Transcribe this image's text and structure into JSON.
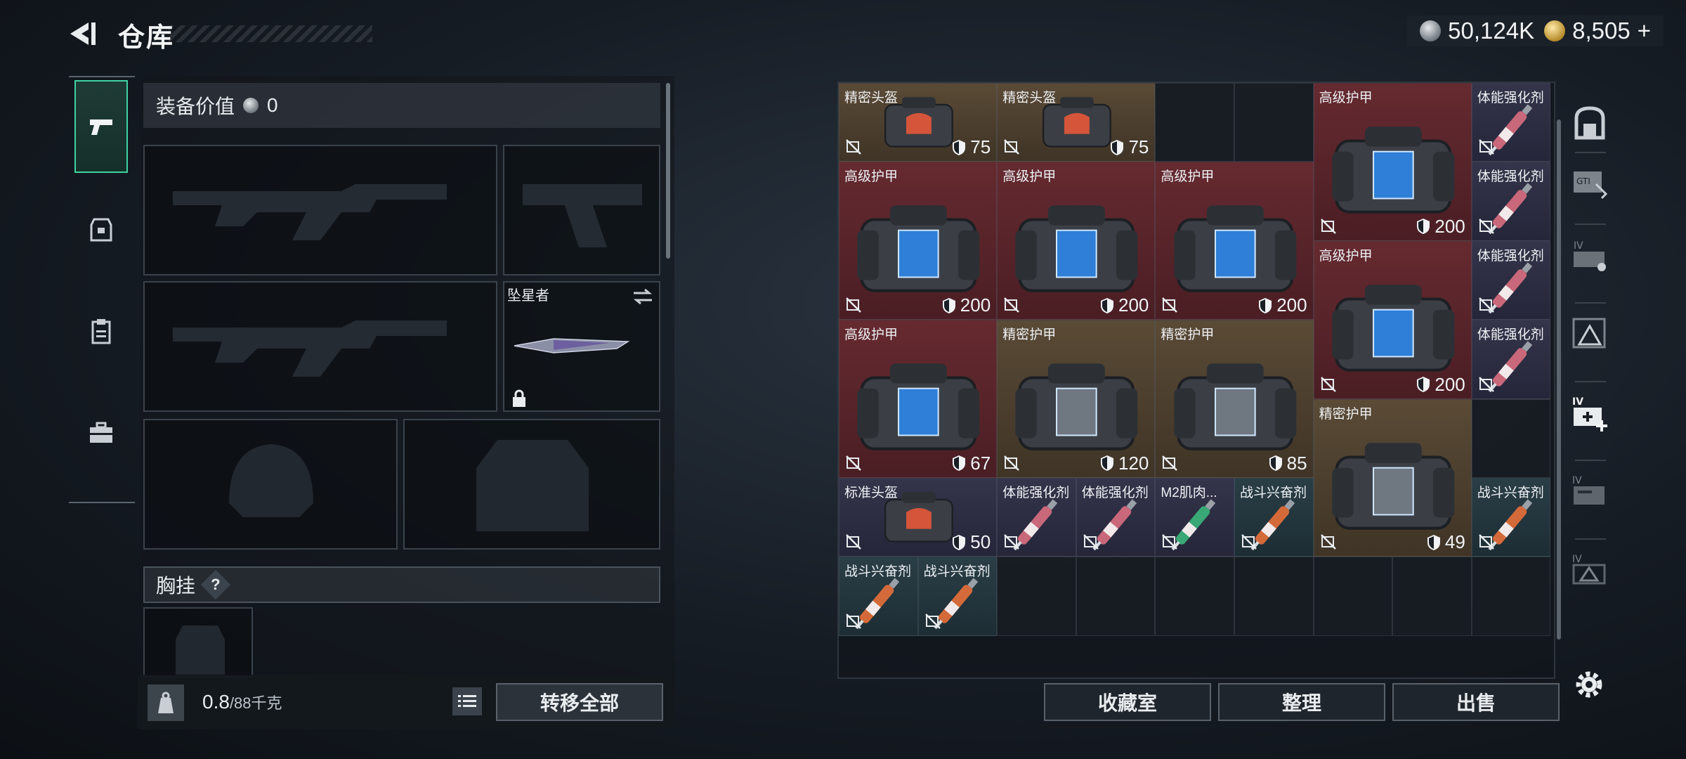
{
  "header": {
    "title": "仓库"
  },
  "currency": {
    "silver": "50,124K",
    "gold": "8,505",
    "add": "+"
  },
  "left": {
    "equip_value_label": "装备价值",
    "equip_value": "0",
    "melee_name": "坠星者",
    "chest_label": "胸挂",
    "help": "?",
    "weight_current": "0.8",
    "weight_max": "/88千克",
    "transfer_all": "转移全部"
  },
  "grid": {
    "items": [
      {
        "label": "精密头盔",
        "dura": "75",
        "color": "gold",
        "art": "helmet"
      },
      {
        "label": "精密头盔",
        "dura": "75",
        "color": "gold",
        "art": "helmet"
      },
      {
        "label": "高级护甲",
        "dura": "200",
        "color": "red",
        "art": "armor-blue"
      },
      {
        "label": "体能强化剂",
        "dura": "",
        "color": "purple",
        "art": "syringe-red"
      },
      {
        "label": "高级护甲",
        "dura": "200",
        "color": "red",
        "art": "armor-blue"
      },
      {
        "label": "高级护甲",
        "dura": "200",
        "color": "red",
        "art": "armor-blue"
      },
      {
        "label": "高级护甲",
        "dura": "200",
        "color": "red",
        "art": "armor-blue"
      },
      {
        "label": "体能强化剂",
        "dura": "",
        "color": "purple",
        "art": "syringe-red"
      },
      {
        "label": "高级护甲",
        "dura": "200",
        "color": "red",
        "art": "armor-blue"
      },
      {
        "label": "体能强化剂",
        "dura": "",
        "color": "purple",
        "art": "syringe-red"
      },
      {
        "label": "高级护甲",
        "dura": "67",
        "color": "red",
        "art": "armor-blue"
      },
      {
        "label": "精密护甲",
        "dura": "120",
        "color": "gold",
        "art": "armor-gray"
      },
      {
        "label": "精密护甲",
        "dura": "85",
        "color": "gold",
        "art": "armor-gray"
      },
      {
        "label": "精密护甲",
        "dura": "49",
        "color": "gold",
        "art": "armor-gray"
      },
      {
        "label": "体能强化剂",
        "dura": "",
        "color": "purple",
        "art": "syringe-red"
      },
      {
        "label": "标准头盔",
        "dura": "50",
        "color": "purple",
        "art": "helmet"
      },
      {
        "label": "体能强化剂",
        "dura": "",
        "color": "purple",
        "art": "syringe-red"
      },
      {
        "label": "体能强化剂",
        "dura": "",
        "color": "purple",
        "art": "syringe-red"
      },
      {
        "label": "M2肌肉...",
        "dura": "",
        "color": "purple",
        "art": "syringe-green"
      },
      {
        "label": "战斗兴奋剂",
        "dura": "",
        "color": "teal",
        "art": "syringe-orange"
      },
      {
        "label": "战斗兴奋剂",
        "dura": "",
        "color": "teal",
        "art": "syringe-orange"
      },
      {
        "label": "战斗兴奋剂",
        "dura": "",
        "color": "teal",
        "art": "syringe-orange"
      },
      {
        "label": "战斗兴奋剂",
        "dura": "",
        "color": "teal",
        "art": "syringe-orange"
      }
    ]
  },
  "buttons": {
    "collection": "收藏室",
    "organize": "整理",
    "sell": "出售"
  },
  "side_icons": [
    "backpack-icon",
    "grid-box-icon",
    "case-iv-icon",
    "case-warning-icon",
    "case-add-icon",
    "case-folder-icon",
    "case-triangle-icon"
  ],
  "colors": {
    "accent": "#3fd3a3",
    "gold_cell": "#5a4a36",
    "red_cell": "#652a30",
    "purple_cell": "#34344a",
    "teal_cell": "#2a3e46"
  }
}
